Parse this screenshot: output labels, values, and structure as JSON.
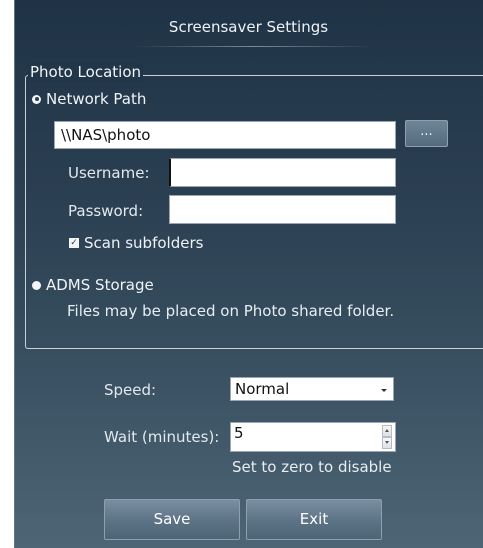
{
  "window": {
    "title": "Screensaver Settings"
  },
  "photo_location": {
    "legend": "Photo Location",
    "network_path": {
      "label": "Network Path",
      "selected": true,
      "path_value": "\\\\NAS\\photo",
      "browse_label": "...",
      "username_label": "Username:",
      "username_value": "",
      "password_label": "Password:",
      "password_value": "",
      "scan_subfolders_label": "Scan subfolders",
      "scan_subfolders_checked": true
    },
    "adms_storage": {
      "label": "ADMS Storage",
      "selected": false,
      "note": "Files may be placed on Photo shared folder."
    }
  },
  "speed": {
    "label": "Speed:",
    "value": "Normal"
  },
  "wait": {
    "label": "Wait (minutes):",
    "value": "5",
    "hint": "Set to zero to disable"
  },
  "buttons": {
    "save": "Save",
    "exit": "Exit"
  },
  "colors": {
    "panel_top": "#1f3346",
    "panel_bottom": "#4d6574",
    "button": "#5c7285",
    "text": "#e8edf2"
  }
}
